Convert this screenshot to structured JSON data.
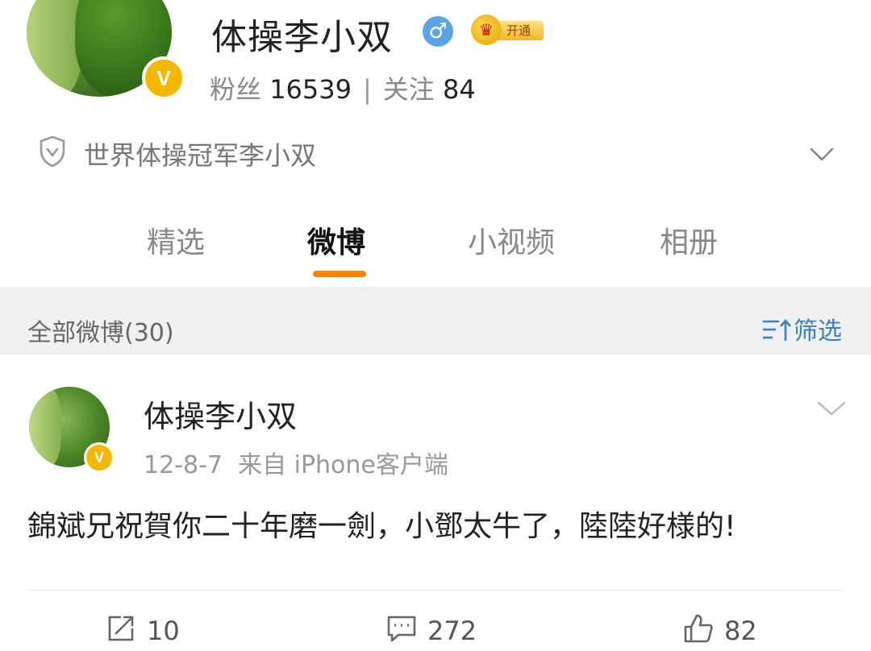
{
  "profile": {
    "name": "体操李小双",
    "gender_symbol": "♂",
    "vip_label": "开通",
    "vip_crown": "♛",
    "verified_symbol": "V",
    "fans_label": "粉丝",
    "fans_count": "16539",
    "following_label": "关注",
    "following_count": "84",
    "separator": "|",
    "verification": "世界体操冠军李小双"
  },
  "tabs": [
    {
      "label": "精选",
      "active": false
    },
    {
      "label": "微博",
      "active": true
    },
    {
      "label": "小视频",
      "active": false
    },
    {
      "label": "相册",
      "active": false
    }
  ],
  "feed": {
    "all_posts_label": "全部微博(30)",
    "filter_label": "筛选"
  },
  "post": {
    "author": "体操李小双",
    "verified_symbol": "V",
    "date": "12-8-7",
    "source": "来自 iPhone客户端",
    "text": "錦斌兄祝賀你二十年磨一劍，小鄧太牛了，陸陸好様的!",
    "reposts": "10",
    "comments": "272",
    "likes": "82"
  },
  "colors": {
    "accent_orange": "#ff8200",
    "link_blue": "#3b7fbf",
    "verified_gold": "#f5b800",
    "gender_blue": "#5aa3e6"
  },
  "icons": {
    "shield": "shield-icon",
    "chevron": "chevron-down-icon",
    "filter": "filter-icon",
    "repost": "repost-icon",
    "comment": "comment-icon",
    "like": "like-icon"
  }
}
